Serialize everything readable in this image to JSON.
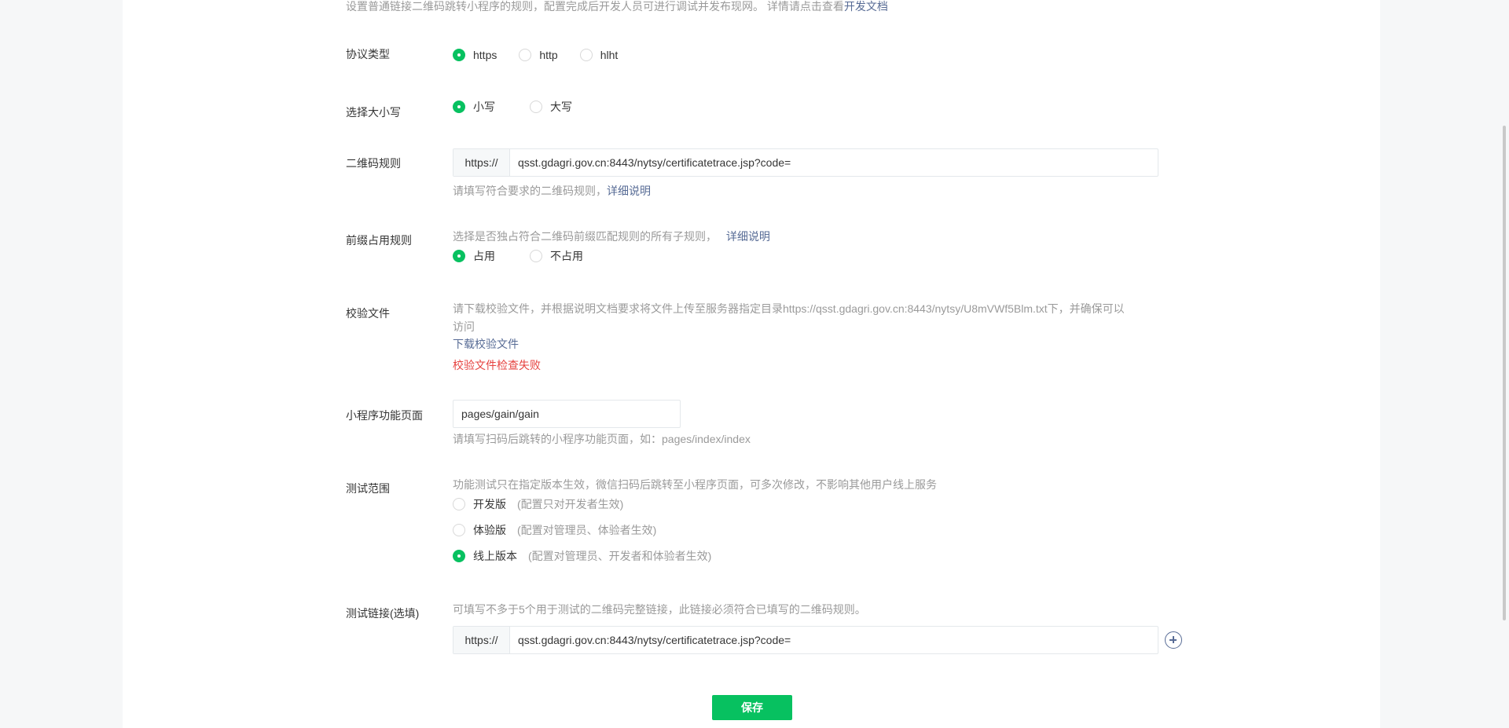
{
  "intro": {
    "text": "设置普通链接二维码跳转小程序的规则，配置完成后开发人员可进行调试并发布现网。 详情请点击查看",
    "link": "开发文档"
  },
  "protocol": {
    "label": "协议类型",
    "options": [
      "https",
      "http",
      "hlht"
    ],
    "selected": "https"
  },
  "case": {
    "label": "选择大小写",
    "options": [
      "小写",
      "大写"
    ],
    "selected": "小写"
  },
  "qr_rule": {
    "label": "二维码规则",
    "prefix": "https://",
    "value": "qsst.gdagri.gov.cn:8443/nytsy/certificatetrace.jsp?code=",
    "hint": "请填写符合要求的二维码规则，",
    "hint_link": "详细说明"
  },
  "prefix_rule": {
    "label": "前缀占用规则",
    "hint": "选择是否独占符合二维码前缀匹配规则的所有子规则，",
    "hint_link": "详细说明",
    "options": [
      "占用",
      "不占用"
    ],
    "selected": "占用"
  },
  "verify": {
    "label": "校验文件",
    "desc_line1": "请下载校验文件，并根据说明文档要求将文件上传至服务器指定目录https://qsst.gdagri.gov.cn:8443/nytsy/U8mVWf5Blm.txt下，并确保可以",
    "desc_line2": "访问",
    "download_link": "下载校验文件",
    "error": "校验文件检查失败"
  },
  "page": {
    "label": "小程序功能页面",
    "value": "pages/gain/gain",
    "hint": "请填写扫码后跳转的小程序功能页面，如：pages/index/index"
  },
  "scope": {
    "label": "测试范围",
    "hint": "功能测试只在指定版本生效，微信扫码后跳转至小程序页面，可多次修改，不影响其他用户线上服务",
    "options": [
      {
        "label": "开发版",
        "note": "(配置只对开发者生效)",
        "checked": false
      },
      {
        "label": "体验版",
        "note": "(配置对管理员、体验者生效)",
        "checked": false
      },
      {
        "label": "线上版本",
        "note": "(配置对管理员、开发者和体验者生效)",
        "checked": true
      }
    ]
  },
  "test_link": {
    "label": "测试链接(选填)",
    "hint": "可填写不多于5个用于测试的二维码完整链接，此链接必须符合已填写的二维码规则。",
    "prefix": "https://",
    "value": "qsst.gdagri.gov.cn:8443/nytsy/certificatetrace.jsp?code="
  },
  "save_label": "保存",
  "colors": {
    "accent": "#07c160",
    "link": "#576b95",
    "error": "#e64340"
  }
}
